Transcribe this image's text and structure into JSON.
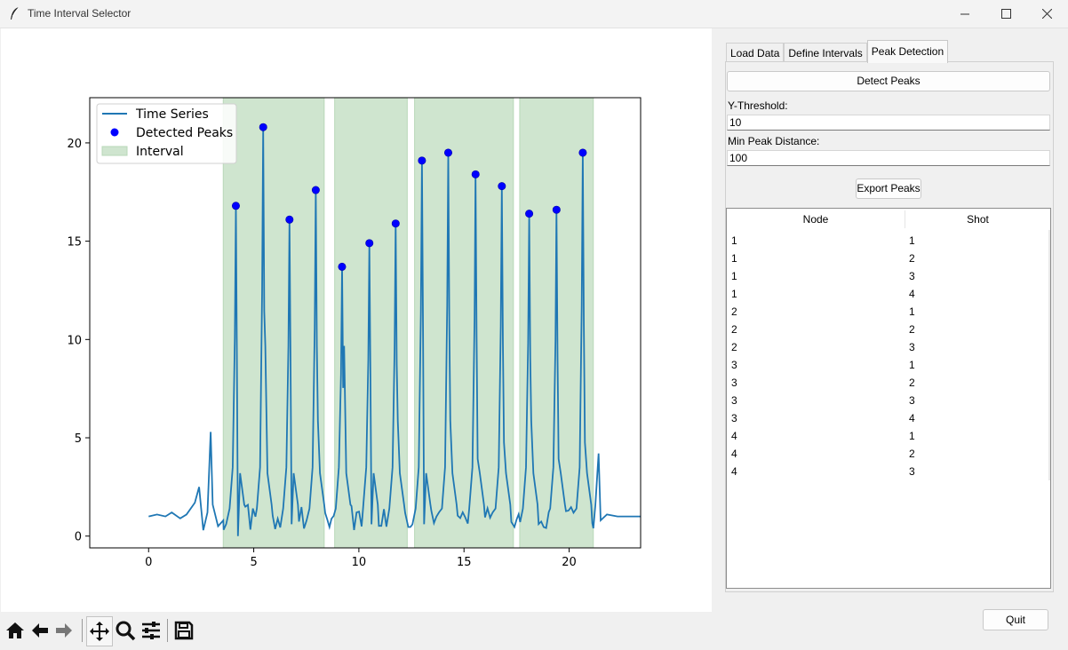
{
  "window": {
    "title": "Time Interval Selector"
  },
  "colors": {
    "series": "#1f77b4",
    "peaks": "#0000ff",
    "interval_fill": "#cfe5cf",
    "interval_edge": "#b8d8b8"
  },
  "toolbar": {
    "icons": [
      "home-icon",
      "back-arrow-icon",
      "forward-arrow-icon",
      "pan-move-icon",
      "zoom-magnifier-icon",
      "configure-subplots-icon",
      "save-floppy-icon"
    ]
  },
  "tabs": [
    {
      "label": "Load Data",
      "active": false
    },
    {
      "label": "Define Intervals",
      "active": false
    },
    {
      "label": "Peak Detection",
      "active": true
    }
  ],
  "peak_panel": {
    "detect_button": "Detect Peaks",
    "threshold_label": "Y-Threshold:",
    "threshold_value": "10",
    "distance_label": "Min Peak Distance:",
    "distance_value": "100",
    "export_button": "Export Peaks"
  },
  "table": {
    "headers": [
      "Node",
      "Shot"
    ],
    "rows": [
      [
        "1",
        "1"
      ],
      [
        "1",
        "2"
      ],
      [
        "1",
        "3"
      ],
      [
        "1",
        "4"
      ],
      [
        "2",
        "1"
      ],
      [
        "2",
        "2"
      ],
      [
        "2",
        "3"
      ],
      [
        "3",
        "1"
      ],
      [
        "3",
        "2"
      ],
      [
        "3",
        "3"
      ],
      [
        "3",
        "4"
      ],
      [
        "4",
        "1"
      ],
      [
        "4",
        "2"
      ],
      [
        "4",
        "3"
      ]
    ]
  },
  "quit_button": "Quit",
  "chart_data": {
    "type": "line",
    "title": "",
    "xlabel": "",
    "ylabel": "",
    "xlim": [
      -2.8,
      23.4
    ],
    "ylim": [
      -0.6,
      22.3
    ],
    "xticks": [
      0,
      5,
      10,
      15,
      20
    ],
    "yticks": [
      0,
      5,
      10,
      15,
      20
    ],
    "grid": false,
    "legend": {
      "position": "upper-left",
      "entries": [
        "Time Series",
        "Detected Peaks",
        "Interval"
      ]
    },
    "intervals": [
      [
        3.55,
        8.35
      ],
      [
        8.85,
        12.3
      ],
      [
        12.65,
        17.35
      ],
      [
        17.65,
        21.15
      ]
    ],
    "peaks": [
      {
        "x": 4.15,
        "y": 16.8
      },
      {
        "x": 5.45,
        "y": 20.8
      },
      {
        "x": 6.7,
        "y": 16.1
      },
      {
        "x": 7.95,
        "y": 17.6
      },
      {
        "x": 9.2,
        "y": 13.7
      },
      {
        "x": 10.5,
        "y": 14.9
      },
      {
        "x": 11.75,
        "y": 15.9
      },
      {
        "x": 13.0,
        "y": 19.1
      },
      {
        "x": 14.25,
        "y": 19.5
      },
      {
        "x": 15.55,
        "y": 18.4
      },
      {
        "x": 16.8,
        "y": 17.8
      },
      {
        "x": 18.1,
        "y": 16.4
      },
      {
        "x": 19.4,
        "y": 16.6
      },
      {
        "x": 20.65,
        "y": 19.5
      }
    ],
    "baseline_points": [
      [
        0.0,
        1.0
      ],
      [
        0.4,
        1.1
      ],
      [
        0.8,
        1.0
      ],
      [
        1.1,
        1.2
      ],
      [
        1.5,
        0.9
      ],
      [
        1.8,
        1.1
      ],
      [
        2.2,
        1.7
      ],
      [
        2.4,
        2.5
      ],
      [
        2.5,
        1.4
      ],
      [
        2.6,
        0.3
      ],
      [
        2.8,
        1.2
      ],
      [
        2.95,
        5.3
      ],
      [
        3.05,
        1.6
      ],
      [
        3.3,
        0.5
      ],
      [
        3.55,
        0.8
      ],
      [
        21.15,
        0.4
      ],
      [
        21.25,
        1.6
      ],
      [
        21.4,
        4.2
      ],
      [
        21.5,
        0.8
      ],
      [
        21.8,
        1.1
      ],
      [
        22.3,
        1.0
      ],
      [
        23.4,
        1.0
      ]
    ]
  }
}
